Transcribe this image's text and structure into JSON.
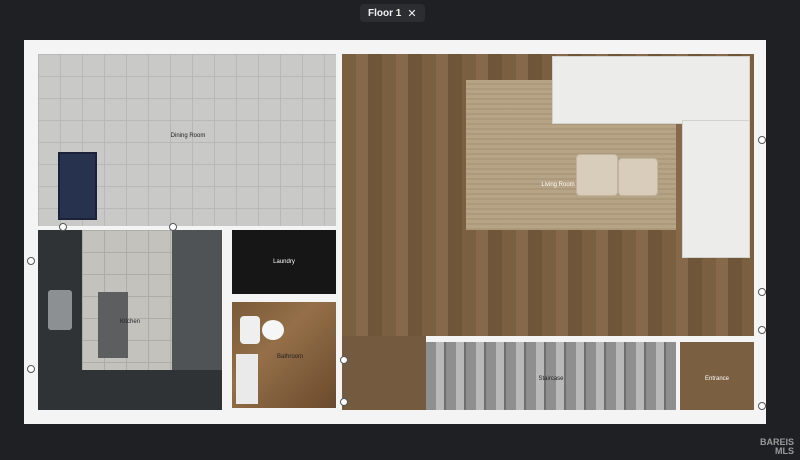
{
  "header": {
    "floor_label": "Floor 1",
    "close_symbol": "✕"
  },
  "rooms": {
    "dining": "Dining Room",
    "kitchen": "Kitchen",
    "laundry": "Laundry",
    "bathroom": "Bathroom",
    "living": "Living Room",
    "staircase": "Staircase",
    "entrance": "Entrance"
  },
  "watermark": {
    "line1": "BAREIS",
    "line2": "MLS"
  },
  "icons": {
    "close": "close-icon"
  },
  "colors": {
    "background": "#1f2024",
    "walls": "#f4f4f4",
    "wood_floor": "#7b5f41"
  }
}
